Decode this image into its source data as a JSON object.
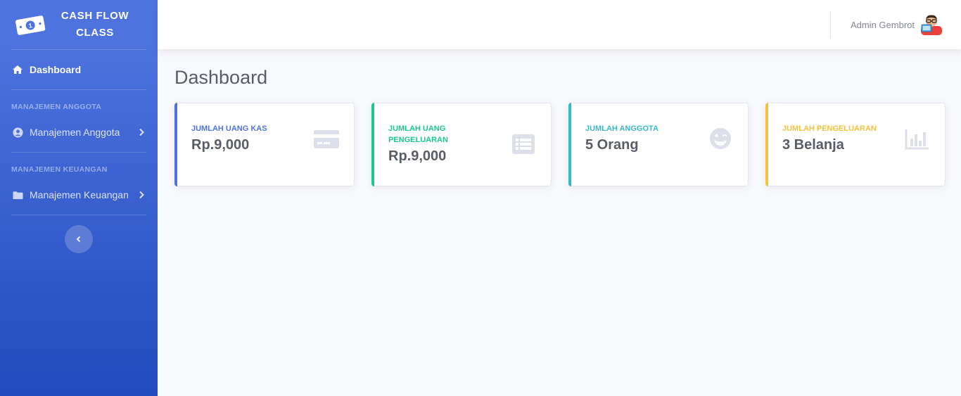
{
  "brand": {
    "title": "CASH FLOW CLASS",
    "icon": "money-bill-icon"
  },
  "sidebar": {
    "dashboard": {
      "label": "Dashboard",
      "icon": "home-icon"
    },
    "sections": [
      {
        "heading": "MANAJEMEN ANGGOTA",
        "item": {
          "label": "Manajemen Anggota",
          "icon": "user-circle-icon"
        }
      },
      {
        "heading": "MANAJEMEN KEUANGAN",
        "item": {
          "label": "Manajemen Keuangan",
          "icon": "folder-icon"
        }
      }
    ],
    "toggle_icon": "chevron-left-icon"
  },
  "topbar": {
    "user_name": "Admin Gembrot",
    "avatar_icon": "programmer-avatar-icon"
  },
  "page": {
    "title": "Dashboard"
  },
  "cards": [
    {
      "label": "JUMLAH UANG KAS",
      "value": "Rp.9,000",
      "accent": "#4e73df",
      "icon": "credit-card-icon"
    },
    {
      "label": "JUMLAH UANG PENGELUARAN",
      "value": "Rp.9,000",
      "accent": "#1cc88a",
      "icon": "list-icon"
    },
    {
      "label": "JUMLAH ANGGOTA",
      "value": "5 Orang",
      "accent": "#36b9cc",
      "icon": "grin-wink-icon"
    },
    {
      "label": "JUMLAH PENGELUARAN",
      "value": "3 Belanja",
      "accent": "#f6c23e",
      "icon": "chart-bar-icon"
    }
  ],
  "colors": {
    "icon_muted": "#dddfeb",
    "text": "#5a5c69"
  }
}
